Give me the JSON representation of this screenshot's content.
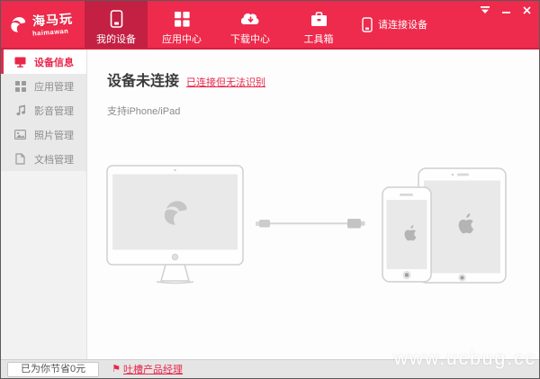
{
  "brand": {
    "name": "海马玩",
    "subtitle": "haimawan"
  },
  "header": {
    "tabs": [
      {
        "label": "我的设备",
        "icon": "phone-icon",
        "active": true
      },
      {
        "label": "应用中心",
        "icon": "grid-icon",
        "active": false
      },
      {
        "label": "下载中心",
        "icon": "cloud-download-icon",
        "active": false
      },
      {
        "label": "工具箱",
        "icon": "toolbox-icon",
        "active": false
      }
    ],
    "connect_status": "请连接设备"
  },
  "sidebar": {
    "items": [
      {
        "label": "设备信息",
        "icon": "monitor-icon",
        "active": true
      },
      {
        "label": "应用管理",
        "icon": "apps-icon",
        "active": false
      },
      {
        "label": "影音管理",
        "icon": "music-icon",
        "active": false
      },
      {
        "label": "照片管理",
        "icon": "photo-icon",
        "active": false
      },
      {
        "label": "文档管理",
        "icon": "document-icon",
        "active": false
      }
    ]
  },
  "main": {
    "title": "设备未连接",
    "link": "已连接但无法识别",
    "support": "支持iPhone/iPad"
  },
  "footer": {
    "savings": "已为你节省0元",
    "feedback": "吐槽产品经理"
  },
  "watermark": "www.ucbug.cc",
  "colors": {
    "accent": "#ee2b4c",
    "accent_dark": "#c32043",
    "link_red": "#e8274b",
    "sidebar_gray": "#e9e9e9",
    "footer_gray": "#e5e5e5"
  }
}
